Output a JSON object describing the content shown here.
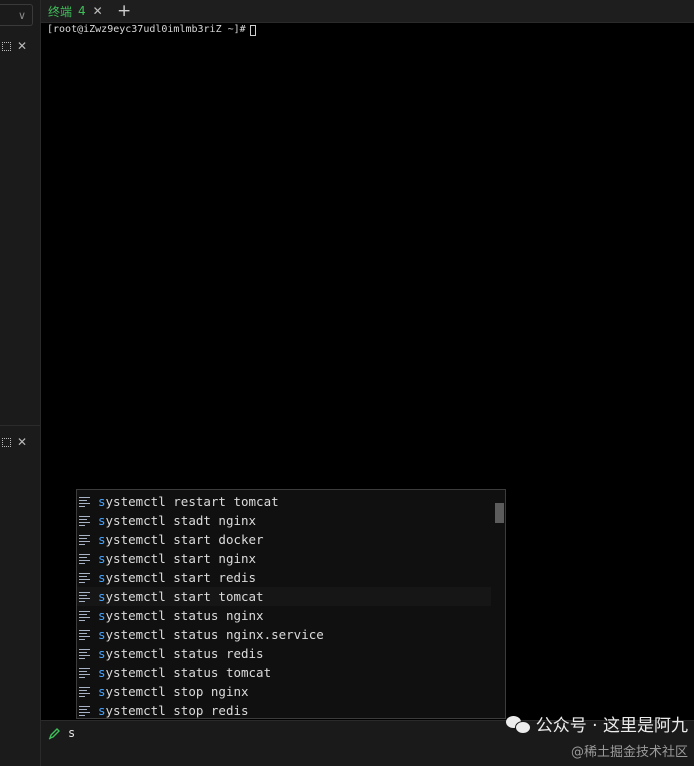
{
  "left_panel": {
    "dropdown_chevron": "∨",
    "pane_close_glyph": "✕"
  },
  "tabbar": {
    "tab_title": "终端",
    "tab_number": "4",
    "tab_close_glyph": "✕",
    "add_glyph": "+"
  },
  "terminal": {
    "prompt": "[root@iZwz9eyc37udl0imlmb3riZ ~]#"
  },
  "autocomplete": {
    "typed_prefix": "s",
    "items": [
      {
        "match": "s",
        "rest": "ystemctl restart tomcat"
      },
      {
        "match": "s",
        "rest": "ystemctl stadt nginx"
      },
      {
        "match": "s",
        "rest": "ystemctl start docker"
      },
      {
        "match": "s",
        "rest": "ystemctl start nginx"
      },
      {
        "match": "s",
        "rest": "ystemctl start redis"
      },
      {
        "match": "s",
        "rest": "ystemctl start tomcat"
      },
      {
        "match": "s",
        "rest": "ystemctl status nginx"
      },
      {
        "match": "s",
        "rest": "ystemctl status nginx.service"
      },
      {
        "match": "s",
        "rest": "ystemctl status redis"
      },
      {
        "match": "s",
        "rest": "ystemctl status tomcat"
      },
      {
        "match": "s",
        "rest": "ystemctl stop nginx"
      },
      {
        "match": "s",
        "rest": "ystemctl stop redis"
      }
    ],
    "highlighted_index": 5
  },
  "inputbar": {
    "icon": "pen-icon",
    "value": "s"
  },
  "watermark": {
    "line1": "公众号 · 这里是阿九",
    "line2": "@稀土掘金技术社区"
  },
  "colors": {
    "accent_green": "#3fbf5a",
    "match_blue": "#4aa6ff"
  }
}
